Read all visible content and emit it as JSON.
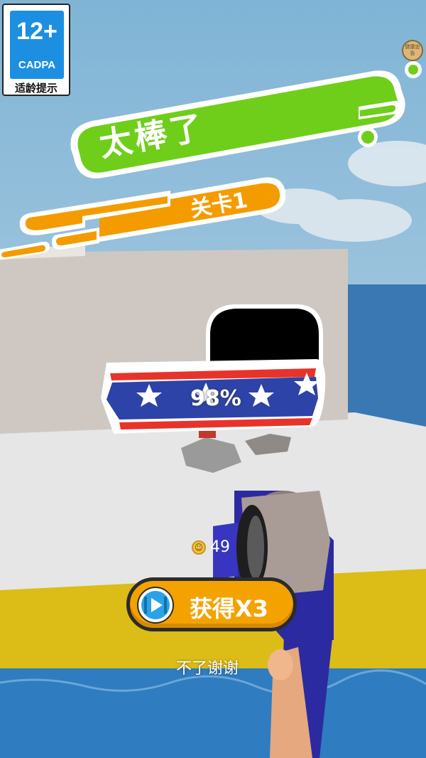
{
  "age_rating": {
    "number": "12+",
    "org": "CADPA",
    "tip": "适龄提示"
  },
  "corner_seal": {
    "text": "健康忠告"
  },
  "result": {
    "title": "太棒了",
    "level": "关卡1",
    "progress": "98%"
  },
  "coins": {
    "icon": "smiley-coin-icon",
    "count": "49"
  },
  "reward_button": {
    "label": "获得X3",
    "icon": "video-play-icon"
  },
  "decline": {
    "label": "不了谢谢"
  },
  "colors": {
    "title_banner": "#6fce1a",
    "level_banner": "#f49b00",
    "ribbon_blue": "#2d43a8",
    "ribbon_red": "#e8332a",
    "button": "#f4a200"
  }
}
